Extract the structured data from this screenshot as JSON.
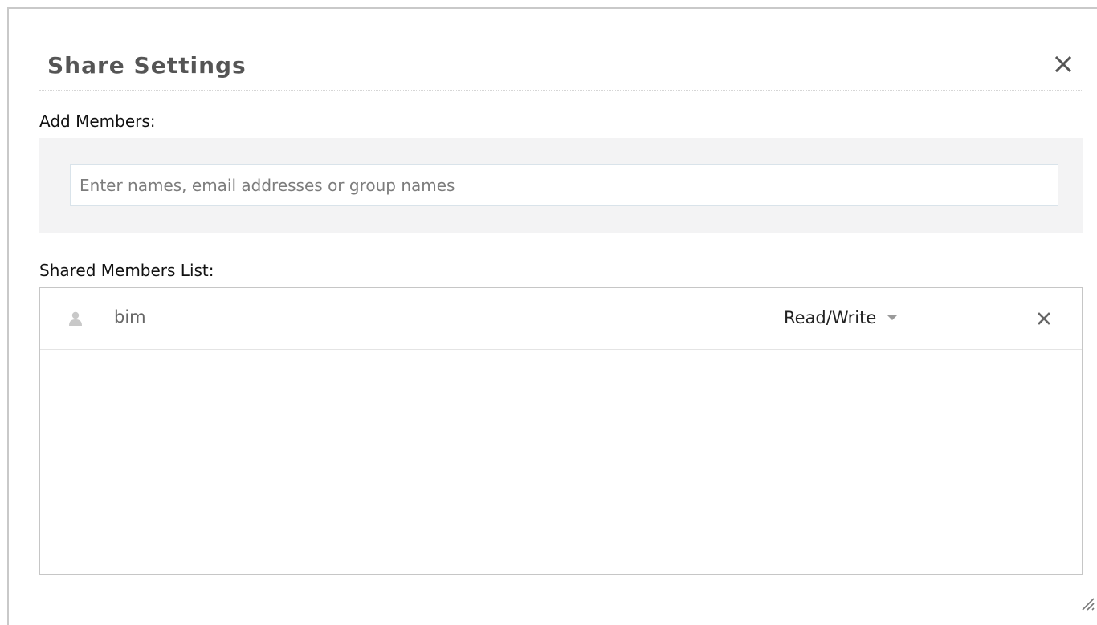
{
  "dialog": {
    "title": "Share Settings",
    "close_icon": "close-icon"
  },
  "add_members": {
    "label": "Add Members:",
    "search": {
      "value": "",
      "placeholder": "Enter names, email addresses or group names"
    }
  },
  "shared_members": {
    "label": "Shared Members List:",
    "members": [
      {
        "icon": "person-icon",
        "name": "bim",
        "permission": "Read/Write",
        "remove_icon": "remove-icon"
      }
    ]
  },
  "colors": {
    "title": "#555555",
    "panel_background": "#f3f3f4",
    "border": "#c6c6c6",
    "muted_text": "#666666"
  }
}
